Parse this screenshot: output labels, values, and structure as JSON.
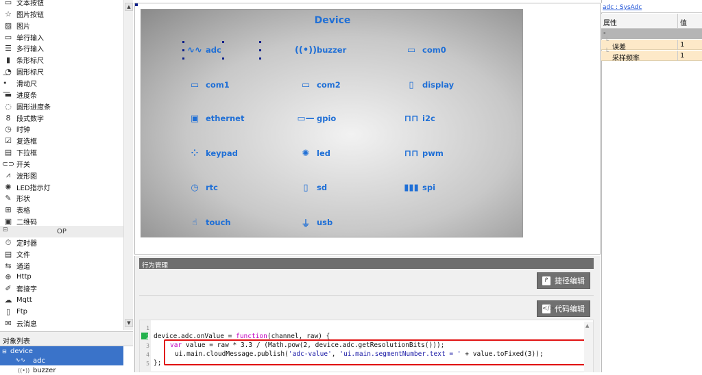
{
  "toolbox": {
    "items": [
      {
        "label": "文本按钮",
        "icon": "text-button-icon",
        "glyph": "▭"
      },
      {
        "label": "图片按钮",
        "icon": "image-button-icon",
        "glyph": "☆"
      },
      {
        "label": "图片",
        "icon": "image-icon",
        "glyph": "▨"
      },
      {
        "label": "单行输入",
        "icon": "single-line-input-icon",
        "glyph": "▭"
      },
      {
        "label": "多行输入",
        "icon": "multi-line-input-icon",
        "glyph": "☰"
      },
      {
        "label": "条形标尺",
        "icon": "bar-ruler-icon",
        "glyph": "▮"
      },
      {
        "label": "圆形标尺",
        "icon": "round-ruler-icon",
        "glyph": "◔"
      },
      {
        "label": "滑动尺",
        "icon": "slider-icon",
        "glyph": "—•—"
      },
      {
        "label": "进度条",
        "icon": "progress-bar-icon",
        "glyph": "▬"
      },
      {
        "label": "圆形进度条",
        "icon": "round-progress-icon",
        "glyph": "◌"
      },
      {
        "label": "段式数字",
        "icon": "segment-number-icon",
        "glyph": "8"
      },
      {
        "label": "时钟",
        "icon": "clock-icon",
        "glyph": "◷"
      },
      {
        "label": "复选框",
        "icon": "checkbox-icon",
        "glyph": "☑"
      },
      {
        "label": "下拉框",
        "icon": "dropdown-icon",
        "glyph": "▤"
      },
      {
        "label": "开关",
        "icon": "switch-icon",
        "glyph": "⊂⊃"
      },
      {
        "label": "波形图",
        "icon": "waveform-icon",
        "glyph": "⩘"
      },
      {
        "label": "LED指示灯",
        "icon": "led-icon",
        "glyph": "✺"
      },
      {
        "label": "形状",
        "icon": "shape-icon",
        "glyph": "✎"
      },
      {
        "label": "表格",
        "icon": "table-icon",
        "glyph": "⊞"
      },
      {
        "label": "二维码",
        "icon": "qrcode-icon",
        "glyph": "▣"
      }
    ],
    "section_op": "OP",
    "section_collapse": "⊟",
    "op_items": [
      {
        "label": "定时器",
        "icon": "timer-icon",
        "glyph": "⏱"
      },
      {
        "label": "文件",
        "icon": "file-icon",
        "glyph": "▤"
      },
      {
        "label": "通道",
        "icon": "channel-icon",
        "glyph": "⇆"
      },
      {
        "label": "Http",
        "icon": "globe-icon",
        "glyph": "⊕"
      },
      {
        "label": "套接字",
        "icon": "socket-icon",
        "glyph": "✐"
      },
      {
        "label": "Mqtt",
        "icon": "mqtt-icon",
        "glyph": "☁"
      },
      {
        "label": "Ftp",
        "icon": "ftp-icon",
        "glyph": "▯"
      },
      {
        "label": "云消息",
        "icon": "cloud-message-icon",
        "glyph": "✉"
      }
    ]
  },
  "object_list": {
    "title": "对象列表",
    "tree": [
      {
        "label": "device",
        "expander": "⊟"
      },
      {
        "label": "adc"
      },
      {
        "label": "buzzer"
      }
    ]
  },
  "canvas": {
    "title": "Device",
    "devices": [
      {
        "label": "adc",
        "icon": "adc-wave-icon",
        "glyph": "∿∿"
      },
      {
        "label": "buzzer",
        "icon": "buzzer-icon",
        "glyph": "((•))"
      },
      {
        "label": "com0",
        "icon": "com0-port-icon",
        "glyph": "▭"
      },
      {
        "label": "com1",
        "icon": "com1-port-icon",
        "glyph": "▭"
      },
      {
        "label": "com2",
        "icon": "com2-port-icon",
        "glyph": "▭"
      },
      {
        "label": "display",
        "icon": "display-icon",
        "glyph": "▯"
      },
      {
        "label": "ethernet",
        "icon": "ethernet-icon",
        "glyph": "▣"
      },
      {
        "label": "gpio",
        "icon": "gpio-icon",
        "glyph": "▭—"
      },
      {
        "label": "i2c",
        "icon": "i2c-icon",
        "glyph": "⊓⊓"
      },
      {
        "label": "keypad",
        "icon": "keypad-icon",
        "glyph": "⁘"
      },
      {
        "label": "led",
        "icon": "led-bulb-icon",
        "glyph": "✺"
      },
      {
        "label": "pwm",
        "icon": "pwm-icon",
        "glyph": "⊓⊓"
      },
      {
        "label": "rtc",
        "icon": "rtc-icon",
        "glyph": "◷"
      },
      {
        "label": "sd",
        "icon": "sd-card-icon",
        "glyph": "▯"
      },
      {
        "label": "spi",
        "icon": "spi-icon",
        "glyph": "▮▮▮"
      },
      {
        "label": "touch",
        "icon": "touch-icon",
        "glyph": "☝"
      },
      {
        "label": "usb",
        "icon": "usb-icon",
        "glyph": "⏚"
      }
    ]
  },
  "behavior": {
    "title": "行为管理",
    "shortcut_edit": "捷径编辑",
    "code_edit": "代码编辑",
    "line_numbers": [
      "1",
      "2",
      "3",
      "4",
      "5"
    ],
    "code": {
      "l2_a": "device.adc.onValue = ",
      "l2_kw": "function",
      "l2_b": "(channel, raw) {",
      "l3_kw": "var",
      "l3_b": " value = raw * 3.3 / (Math.pow(2, device.adc.getResolutionBits()));",
      "l4_a": "ui.main.cloudMessage.publish(",
      "l4_s1": "'adc-value'",
      "l4_b": ", ",
      "l4_s2": "'ui.main.segmentNumber.text = '",
      "l4_c": " + value.toFixed(3));",
      "l5": "};"
    }
  },
  "properties": {
    "title": "adc : SysAdc",
    "col_attr": "属性",
    "col_value": "值",
    "group": "-",
    "rows": [
      {
        "name": "误差",
        "value": "1"
      },
      {
        "name": "采样频率",
        "value": "1"
      }
    ]
  },
  "colors": {
    "device_label": "#1f6fd6",
    "highlight_box": "#e01010",
    "selection": "#3a73c9",
    "property_row": "#fde9c8"
  }
}
